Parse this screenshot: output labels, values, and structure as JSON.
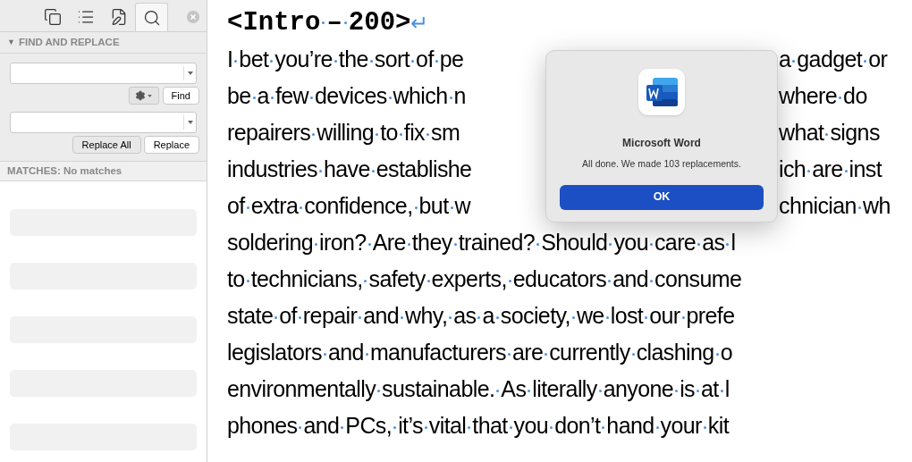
{
  "sidebar": {
    "tabs": [
      {
        "kind": "pages",
        "selected": false
      },
      {
        "kind": "outline",
        "selected": false
      },
      {
        "kind": "edits",
        "selected": false
      },
      {
        "kind": "search",
        "selected": true
      }
    ],
    "section": {
      "title": "FIND AND REPLACE",
      "toggle": "▼",
      "expanded": true
    },
    "find_button": "Find",
    "replace_all_button": "Replace All",
    "replace_button": "Replace",
    "matches": "MATCHES: No matches"
  },
  "document": {
    "heading": "<Intro – 200>",
    "paragraph_mark": "↵",
    "lines": [
      {
        "left": "I bet you’re the sort of pe",
        "right": "a gadget or"
      },
      {
        "left": "be a few devices which n",
        "right": "where do"
      },
      {
        "left": "repairers willing to fix sm",
        "right": "what signs"
      },
      {
        "left": "industries have establishe",
        "right": "ich are inst"
      },
      {
        "left": "of extra confidence, but w",
        "right": "chnician wh"
      },
      {
        "left": "soldering iron? Are they trained? Should you care as l"
      },
      {
        "left": "to technicians, safety experts, educators and consume"
      },
      {
        "left": "state of repair and why, as a society, we lost our prefe"
      },
      {
        "left": "legislators and manufacturers are currently clashing o"
      },
      {
        "left": "environmentally sustainable. As literally anyone is at l"
      },
      {
        "left": "phones and PCs, it’s vital that you don’t hand your kit"
      }
    ]
  },
  "dialog": {
    "title": "Microsoft Word",
    "message": "All done. We made 103 replacements.",
    "ok_button": "OK"
  }
}
